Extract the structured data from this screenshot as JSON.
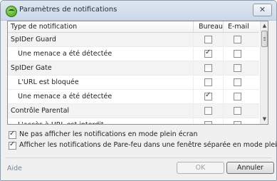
{
  "window": {
    "title": "Paramètres de notifications",
    "app_icon": "spider-icon",
    "close_glyph": "✕"
  },
  "grid": {
    "columns": [
      "Type de notification",
      "Bureau",
      "E-mail"
    ],
    "rows": [
      {
        "label": "SpIDer Guard",
        "level": 0,
        "bureau": false,
        "email": false
      },
      {
        "label": "Une menace a été détectée",
        "level": 1,
        "bureau": true,
        "email": false
      },
      {
        "label": "SpIDer Gate",
        "level": 0,
        "bureau": false,
        "email": false
      },
      {
        "label": "L'URL est bloquée",
        "level": 1,
        "bureau": false,
        "email": false
      },
      {
        "label": "Une menace a été détectée",
        "level": 1,
        "bureau": true,
        "email": false
      },
      {
        "label": "Contrôle Parental",
        "level": 0,
        "bureau": false,
        "email": false
      },
      {
        "label": "L'accès à URL est interdit",
        "level": 1,
        "bureau": false,
        "email": false
      }
    ]
  },
  "options": [
    {
      "label": "Ne pas afficher les notifications en mode plein écran",
      "checked": true
    },
    {
      "label": "Afficher les notifications de Pare-feu dans une fenêtre séparée en mode plein écran",
      "checked": true
    }
  ],
  "footer": {
    "help_label": "Aide",
    "ok_label": "OK",
    "cancel_label": "Annuler"
  }
}
